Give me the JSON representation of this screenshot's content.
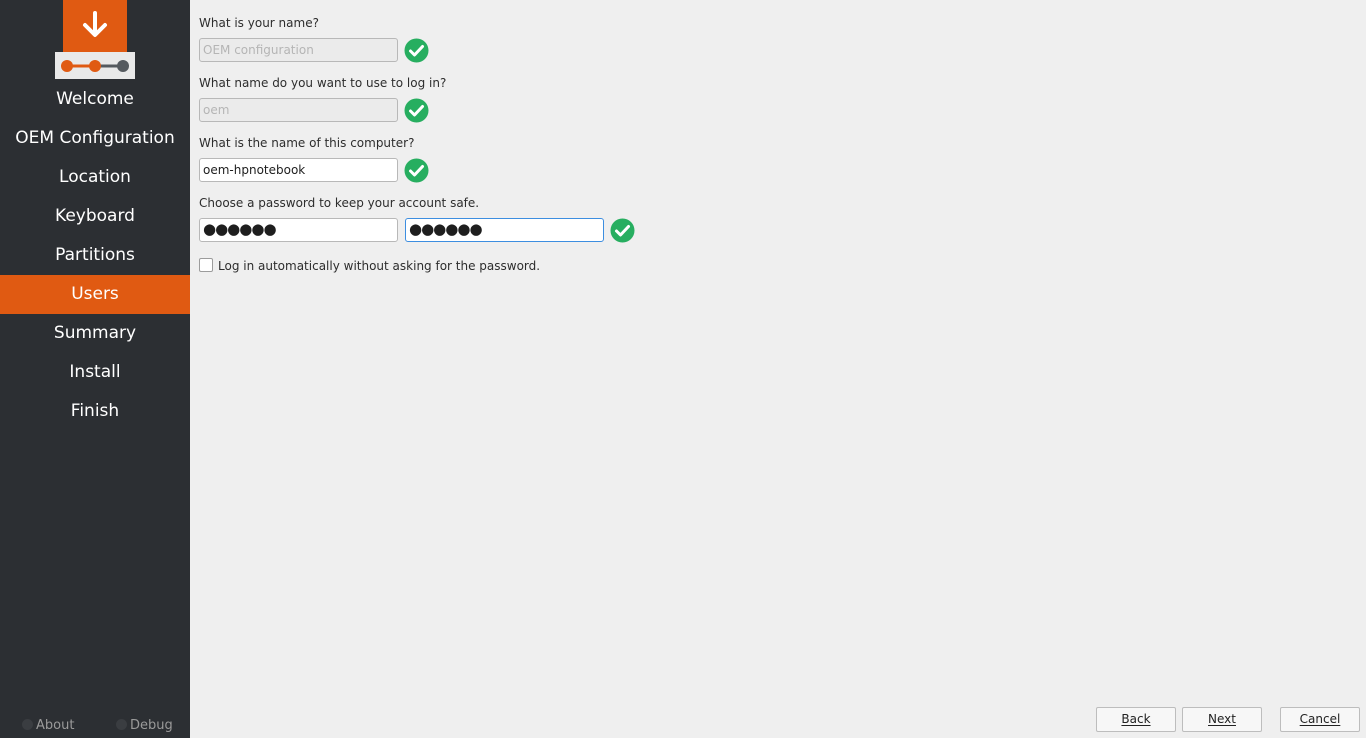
{
  "sidebar": {
    "logo_icon": "download-arrow-icon",
    "progress_icon": "progress-dots-icon",
    "steps": [
      {
        "label": "Welcome",
        "active": false
      },
      {
        "label": "OEM Configuration",
        "active": false
      },
      {
        "label": "Location",
        "active": false
      },
      {
        "label": "Keyboard",
        "active": false
      },
      {
        "label": "Partitions",
        "active": false
      },
      {
        "label": "Users",
        "active": true
      },
      {
        "label": "Summary",
        "active": false
      },
      {
        "label": "Install",
        "active": false
      },
      {
        "label": "Finish",
        "active": false
      }
    ],
    "footer": {
      "about_label": "About",
      "debug_label": "Debug"
    }
  },
  "form": {
    "name_label": "What is your name?",
    "name_value": "OEM configuration",
    "login_label": "What name do you want to use to log in?",
    "login_value": "oem",
    "computer_label": "What is the name of this computer?",
    "computer_value": "oem-hpnotebook",
    "password_label": "Choose a password to keep your account safe.",
    "password_mask": "●●●●●●",
    "password_confirm_mask": "●●●●●●",
    "autologin_label": "Log in automatically without asking for the password.",
    "autologin_checked": false,
    "valid_icon": "check-circle-icon"
  },
  "buttons": {
    "back": "Back",
    "next": "Next",
    "cancel": "Cancel"
  },
  "colors": {
    "accent": "#e05a12",
    "sidebar_bg": "#2c2f33",
    "valid_green": "#27ae60"
  }
}
